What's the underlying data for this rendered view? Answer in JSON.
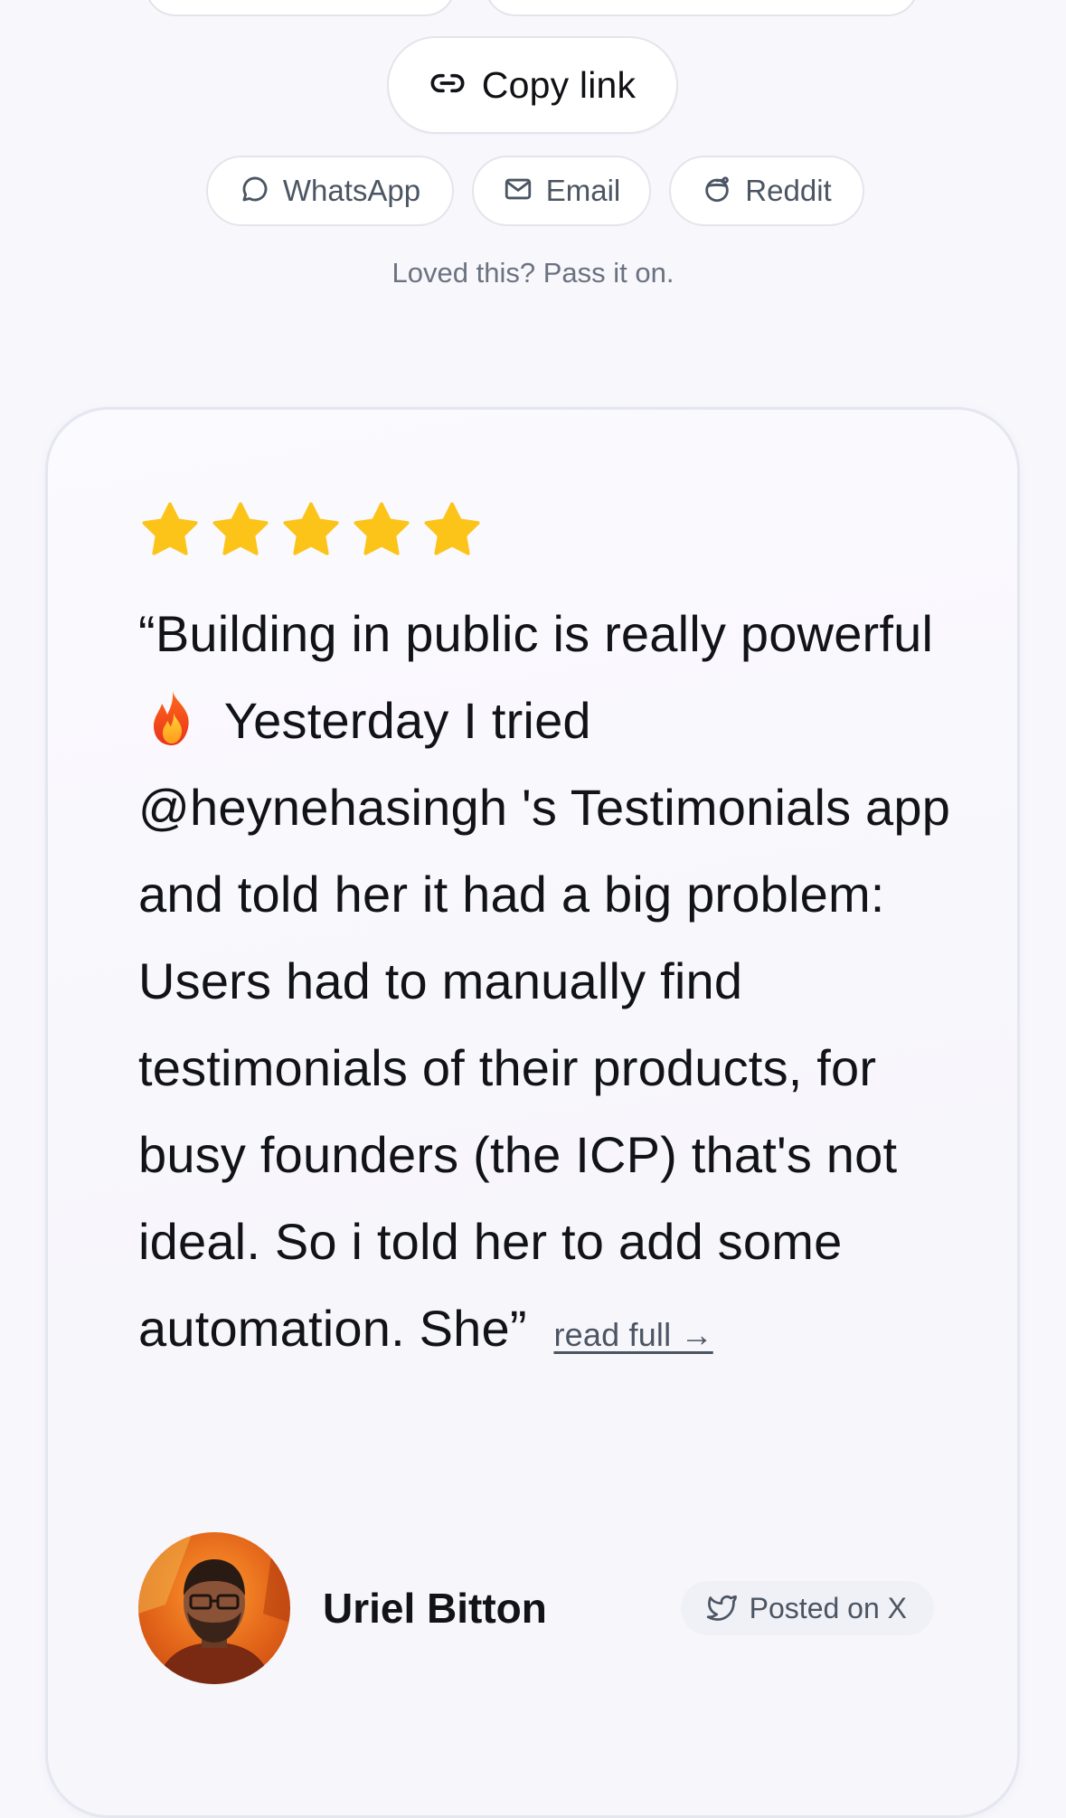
{
  "share": {
    "copy_link": {
      "label": "Copy link",
      "icon": "link-icon"
    },
    "buttons": [
      {
        "label": "WhatsApp",
        "icon": "chat-bubble-icon"
      },
      {
        "label": "Email",
        "icon": "mail-icon"
      },
      {
        "label": "Reddit",
        "icon": "reddit-icon"
      }
    ],
    "caption": "Loved this? Pass it on."
  },
  "testimonial": {
    "rating": 5,
    "rating_max": 5,
    "star_color": "#fcc419",
    "quote_before_emoji": "“Building in public is really powerful",
    "emoji": "fire",
    "quote_after_emoji": "Yesterday I tried @heynehasingh 's Testimonials app and told her it had a big problem: Users had to manually find testimonials of their products, for busy founders (the ICP) that's not ideal. So i told her to add some automation. She”",
    "read_full": "read full →",
    "author": {
      "name": "Uriel Bitton",
      "avatar": "author-avatar"
    },
    "source": {
      "label": "Posted on X",
      "icon": "twitter-bird-icon"
    }
  }
}
